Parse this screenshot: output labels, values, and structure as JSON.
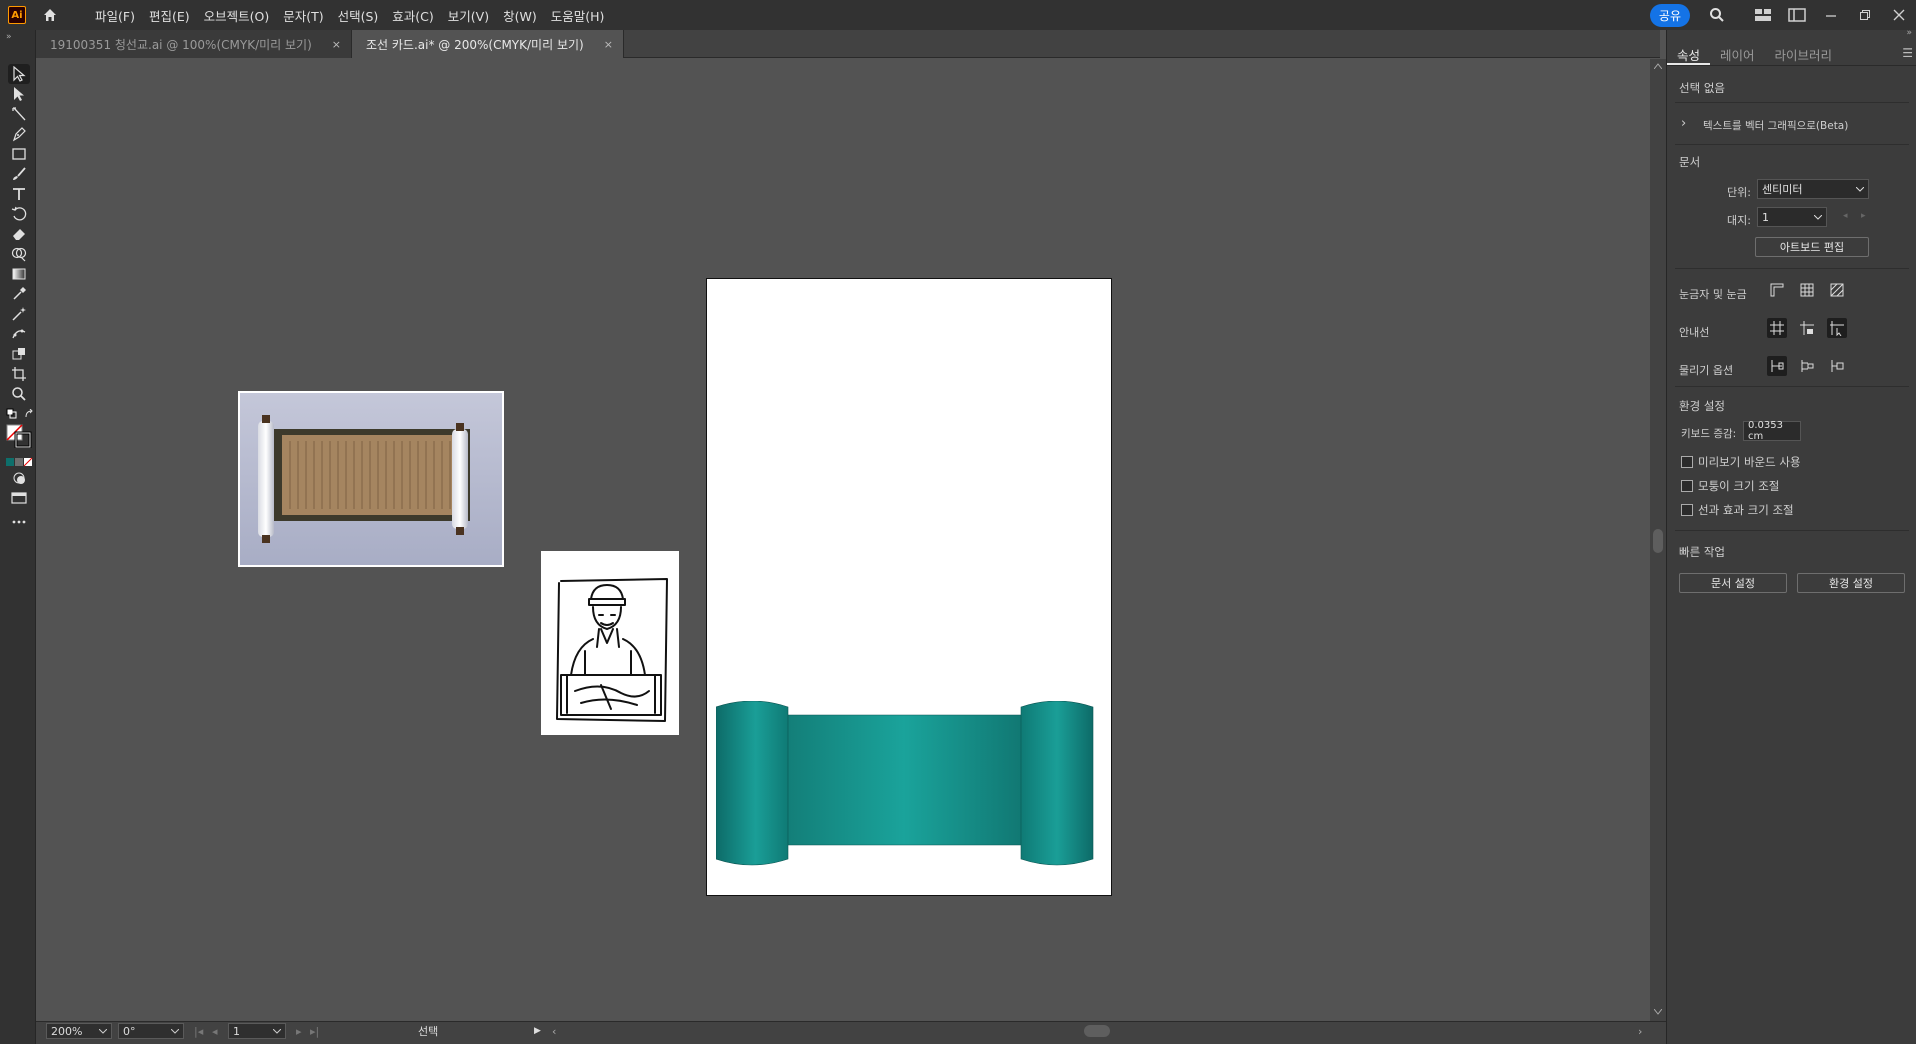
{
  "app": {
    "logo": "Ai"
  },
  "menu": [
    "파일(F)",
    "편집(E)",
    "오브젝트(O)",
    "문자(T)",
    "선택(S)",
    "효과(C)",
    "보기(V)",
    "창(W)",
    "도움말(H)"
  ],
  "share_label": "공유",
  "tabs": [
    {
      "label": "19100351 청선교.ai @ 100%(CMYK/미리 보기)",
      "close": "×"
    },
    {
      "label": "조선 카드.ai* @ 200%(CMYK/미리 보기)",
      "close": "×"
    }
  ],
  "tools": [
    "selection-tool",
    "direct-selection-tool",
    "line-tool",
    "pen-tool",
    "rectangle-tool",
    "paintbrush-tool",
    "type-tool",
    "rotate-tool",
    "eraser-tool",
    "shape-builder-tool",
    "gradient-tool",
    "eyedropper-tool",
    "magic-wand-tool",
    "puppet-warp-tool",
    "live-paint-tool",
    "artboard-tool",
    "zoom-tool"
  ],
  "panel": {
    "tabs": [
      "속성",
      "레이어",
      "라이브러리"
    ],
    "selection": "선택 없음",
    "vectorize": "텍스트를 벡터 그래픽으로(Beta)",
    "document_section": "문서",
    "units_label": "단위:",
    "units_value": "센티미터",
    "artboard_label": "대지:",
    "artboard_value": "1",
    "edit_artboard": "아트보드 편집",
    "rulers_grids": "눈금자 및 눈금",
    "guides": "안내선",
    "snap_options": "물리기 옵션",
    "preferences": "환경 설정",
    "keyboard_increment_label": "키보드 증감:",
    "keyboard_increment_value": "0.0353 cm",
    "use_preview_bounds": "미리보기 바운드 사용",
    "scale_corners": "모퉁이 크기 조절",
    "scale_strokes": "선과 효과 크기 조절",
    "quick_actions": "빠른 작업",
    "document_setup": "문서 설정",
    "preferences_button": "환경 설정"
  },
  "status": {
    "zoom": "200%",
    "rotation": "0°",
    "artboard_number": "1",
    "tool_label": "선택"
  },
  "colors": {
    "teal_dark": "#0e6f6b",
    "teal_light": "#1aa39b",
    "accent_blue": "#1473e6"
  }
}
